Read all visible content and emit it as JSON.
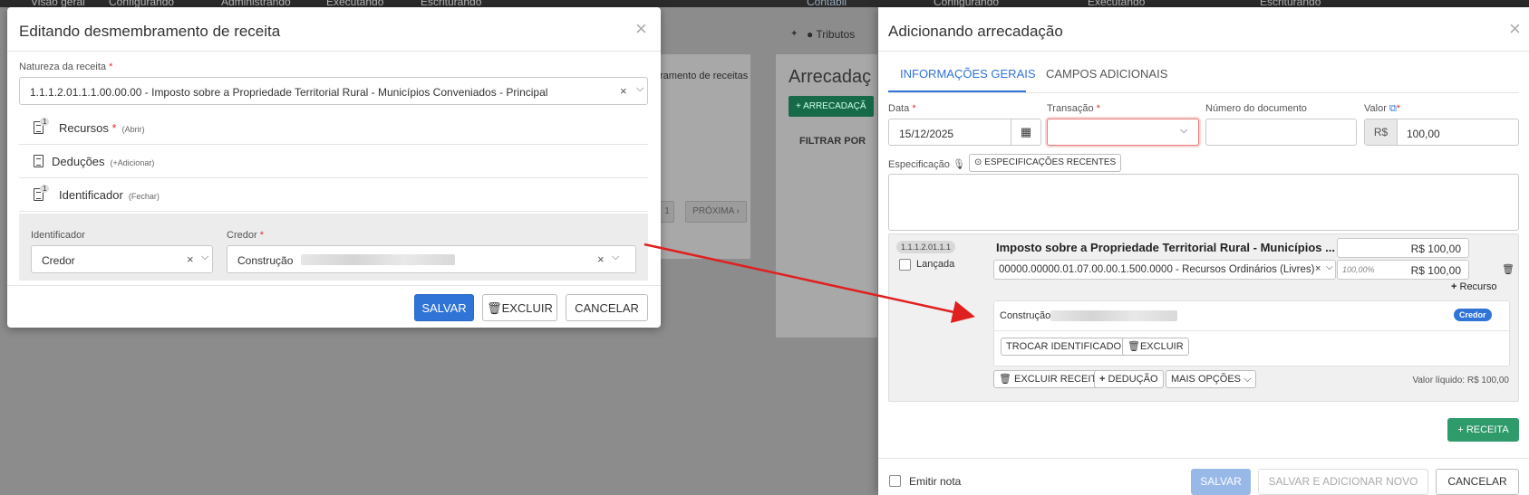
{
  "background": {
    "nav_left": [
      "Visão geral",
      "Configurando",
      "Administrando",
      "Executando",
      "Escriturando"
    ],
    "nav_right_brand": "Contábil",
    "nav_right": [
      "Visão geral",
      "Configurando",
      "Administrando",
      "Executando",
      "Escriturando"
    ],
    "crumb_right": "Tributos",
    "page_title_right": "Arrecadaç",
    "add_btn": "+ ARRECADAÇÃ",
    "filter_label": "FILTRAR POR",
    "left_partial_text": "ramento de receitas",
    "page_num": "1",
    "next_label": "PRÓXIMA"
  },
  "left_modal": {
    "title": "Editando desmembramento de receita",
    "natureza_label": "Natureza da receita",
    "natureza_value": "1.1.1.2.01.1.1.00.00.00 - Imposto sobre a Propriedade Territorial Rural - Municípios Conveniados - Principal",
    "sections": [
      {
        "label": "Recursos",
        "required": "*",
        "action": "(Abrir)",
        "badge": "1"
      },
      {
        "label": "Deduções",
        "required": "",
        "action": "(+Adicionar)",
        "badge": ""
      },
      {
        "label": "Identificador",
        "required": "",
        "action": "(Fechar)",
        "badge": "1"
      }
    ],
    "identificador_label": "Identificador",
    "identificador_value": "Credor",
    "credor_label": "Credor",
    "credor_value": "Construção",
    "save_label": "SALVAR",
    "delete_label": "EXCLUIR",
    "cancel_label": "CANCELAR"
  },
  "right_modal": {
    "title": "Adicionando arrecadação",
    "tabs": [
      "INFORMAÇÕES GERAIS",
      "CAMPOS ADICIONAIS"
    ],
    "data_label": "Data",
    "data_value": "15/12/2025",
    "transacao_label": "Transação",
    "transacao_value": "",
    "numero_label": "Número do documento",
    "numero_value": "",
    "valor_label": "Valor",
    "valor_prefix": "R$",
    "valor_value": "100,00",
    "especificacao_label": "Especificação",
    "recent_specs_label": "ESPECIFICAÇÕES RECENTES",
    "receita": {
      "code": "1.1.1.2.01.1.1",
      "lancada_label": "Lançada",
      "title": "Imposto sobre a Propriedade Territorial Rural - Municípios ...",
      "total": "R$ 100,00",
      "recurso": "00000.00000.01.07.00.00.1.500.0000 - Recursos Ordinários (Livres)",
      "percent": "100,00%",
      "recurso_value": "R$ 100,00",
      "add_recurso": "Recurso",
      "credor_name": "Construção",
      "credor_badge": "Credor",
      "trocar_label": "TROCAR IDENTIFICADOR",
      "excluir_label": "EXCLUIR",
      "excluir_receita_label": "EXCLUIR RECEITA",
      "deducao_label": "DEDUÇÃO",
      "mais_opcoes_label": "MAIS OPÇÕES",
      "valor_liquido": "Valor líquido: R$ 100,00"
    },
    "add_receita_label": "RECEITA",
    "emitir_nota_label": "Emitir nota",
    "save_label": "SALVAR",
    "save_new_label": "SALVAR E ADICIONAR NOVO",
    "cancel_label": "CANCELAR"
  },
  "colors": {
    "primary": "#2f74d6",
    "success": "#2f9a6a",
    "required": "#dd3333",
    "arrow": "#e02020"
  }
}
